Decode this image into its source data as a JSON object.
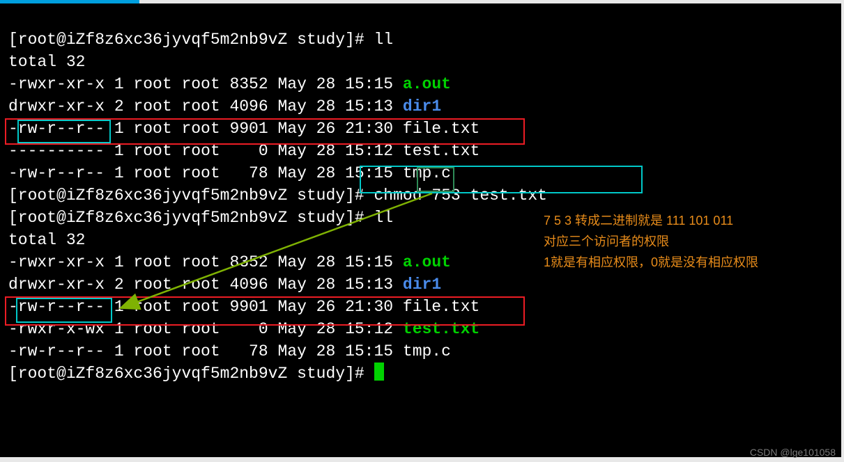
{
  "prompt1": "[root@iZf8z6xc36jyvqf5m2nb9vZ study]# ",
  "cmd_ll": "ll",
  "total": "total 32",
  "ls1": {
    "l0": "-rwxr-xr-x 1 root root 8352 May 28 15:15 ",
    "f0": "a.out",
    "l1": "drwxr-xr-x 2 root root 4096 May 28 15:13 ",
    "f1": "dir1",
    "l2": "-rw-r--r-- 1 root root 9901 May 26 21:30 file.txt",
    "l3_pre": "-",
    "l3_perm": "---------",
    "l3_rest": " 1 root root    0 May 28 15:12 test.txt",
    "l4": "-rw-r--r-- 1 root root   78 May 28 15:15 tmp.c"
  },
  "cmd_chmod_a": "chmod ",
  "cmd_chmod_b": "753",
  "cmd_chmod_c": " test.txt",
  "ls2": {
    "l0": "-rwxr-xr-x 1 root root 8352 May 28 15:15 ",
    "f0": "a.out",
    "l1": "drwxr-xr-x 2 root root 4096 May 28 15:13 ",
    "f1": "dir1",
    "l2": "-rw-r--r-- 1 root root 9901 May 26 21:30 file.txt",
    "l3_pre": "-",
    "l3_perm": "rwxr-x-wx",
    "l3_rest": " 1 root root    0 May 28 15:12 ",
    "l3_file": "test.txt",
    "l4": "-rw-r--r-- 1 root root   78 May 28 15:15 tmp.c"
  },
  "annot1": "7 5 3 转成二进制就是 111 101 011",
  "annot2": "对应三个访问者的权限",
  "annot3": "1就是有相应权限，0就是没有相应权限",
  "watermark": "CSDN @lge101058"
}
